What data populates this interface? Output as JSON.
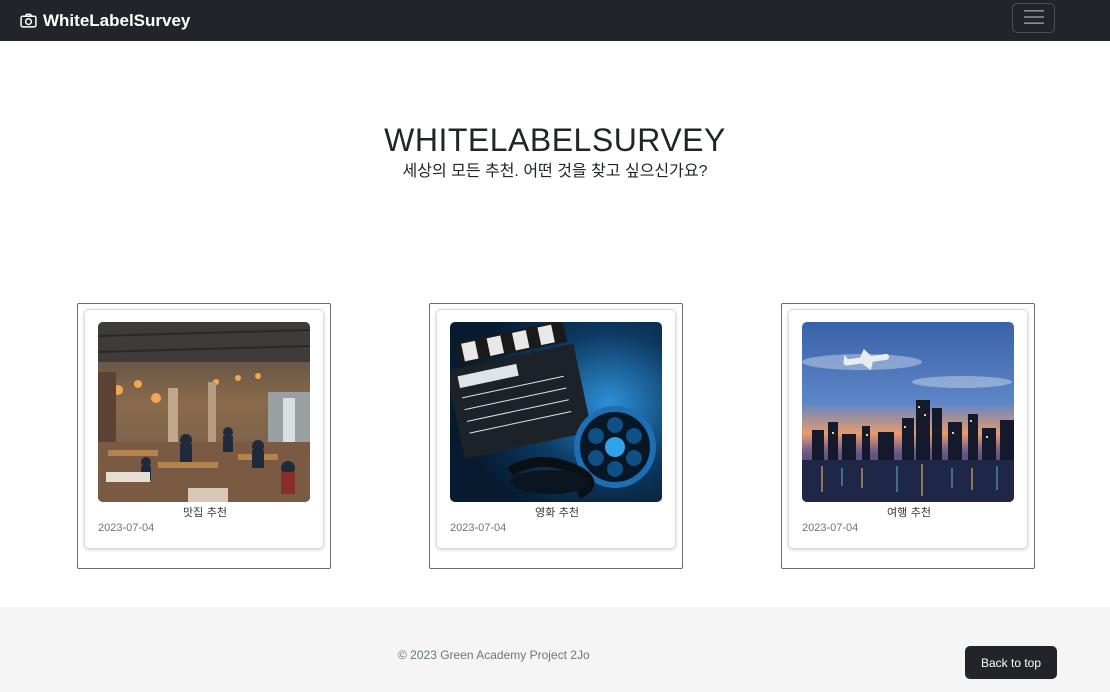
{
  "navbar": {
    "brand": "WhiteLabelSurvey",
    "brand_icon": "camera-icon",
    "toggle_icon": "hamburger-menu-icon"
  },
  "hero": {
    "title": "WHITELABELSURVEY",
    "subtitle": "세상의 모든 추천. 어떤 것을 찾고 싶으신가요?"
  },
  "cards": [
    {
      "title": "맛집 추천",
      "date": "2023-07-04",
      "image": "restaurant-photo"
    },
    {
      "title": "영화 추천",
      "date": "2023-07-04",
      "image": "movie-clapperboard-photo"
    },
    {
      "title": "여행 추천",
      "date": "2023-07-04",
      "image": "travel-city-airplane-photo"
    }
  ],
  "footer": {
    "copyright": "© 2023 Green Academy Project 2Jo",
    "back_to_top": "Back to top"
  },
  "colors": {
    "navbar_bg": "#212529",
    "footer_bg": "#f5f5f5",
    "button_bg": "#212529"
  }
}
